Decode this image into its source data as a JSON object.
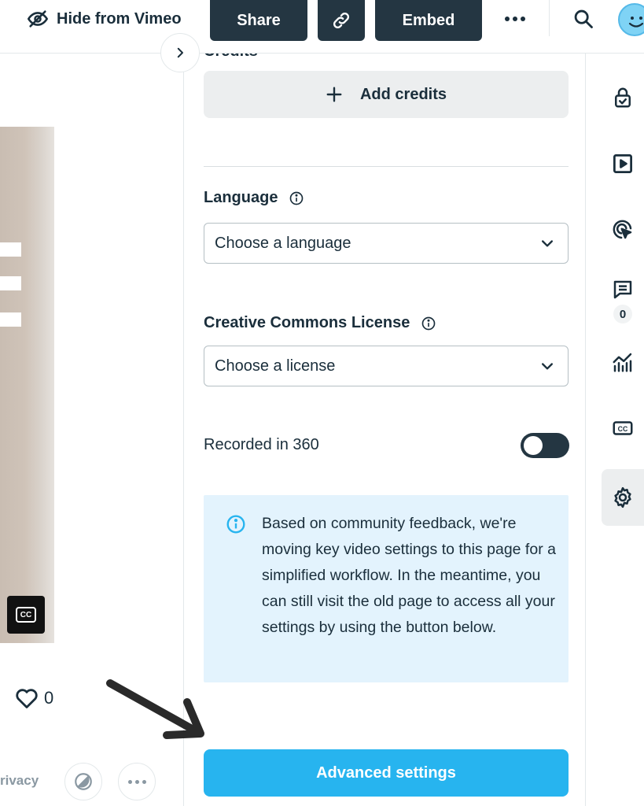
{
  "topbar": {
    "hide_label": "Hide from Vimeo",
    "share_label": "Share",
    "embed_label": "Embed"
  },
  "video": {
    "cc_label": "CC",
    "likes_count": "0",
    "privacy_label": "rivacy"
  },
  "settings": {
    "credits_heading": "Credits",
    "add_credits_label": "Add credits",
    "language_label": "Language",
    "language_value": "Choose a language",
    "license_label": "Creative Commons License",
    "license_value": "Choose a license",
    "recorded_360_label": "Recorded in 360",
    "recorded_360_enabled": false,
    "info_text": "Based on community feedback, we're moving key video settings to this page for a simplified workflow. In the meantime, you can still visit the old page to access all your settings by using the button below.",
    "advanced_button_label": "Advanced settings"
  },
  "rail": {
    "comments_count": "0",
    "cc_label": "CC"
  },
  "icons": {
    "hide": "eye-slash-icon",
    "link": "link-icon",
    "more": "more-dots-icon",
    "search": "search-icon",
    "avatar": "smiley-avatar",
    "collapse": "chevron-right-icon",
    "add": "plus-icon",
    "info": "info-icon",
    "select": "chevron-down-icon",
    "heart": "heart-icon",
    "privacy": "lock-check-icon",
    "player": "play-square-icon",
    "interactive": "cursor-target-icon",
    "comments": "comment-icon",
    "analytics": "analytics-icon",
    "captions": "cc-icon",
    "settings": "gear-icon"
  },
  "colors": {
    "dark_button": "#243642",
    "accent_blue": "#27b4ef",
    "info_background": "#e3f3fd",
    "info_icon": "#27b4ef",
    "text": "#1a2e3b"
  }
}
